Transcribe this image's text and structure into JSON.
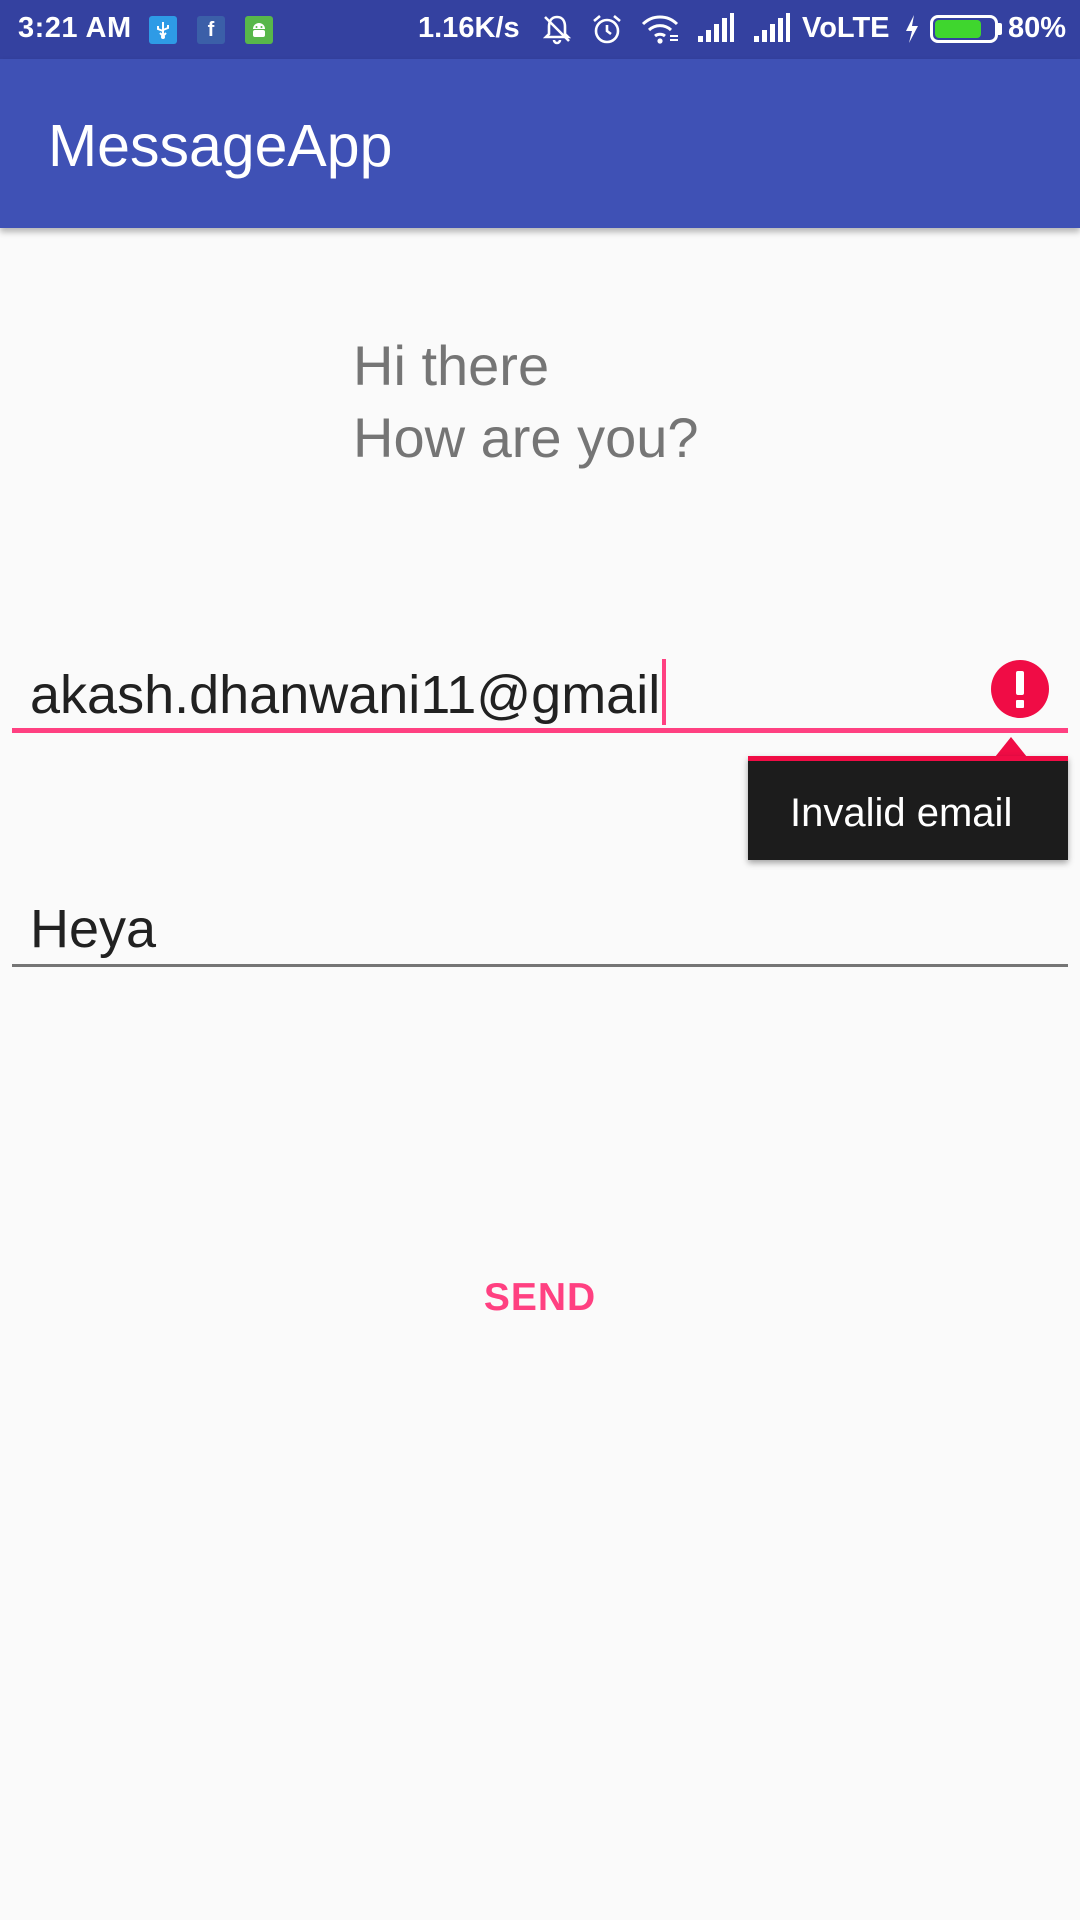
{
  "status_bar": {
    "time": "3:21 AM",
    "network_speed": "1.16K/s",
    "network_type": "VoLTE",
    "battery_percent": "80%",
    "battery_level": 0.8,
    "notification_icons": [
      "usb-icon",
      "facebook-icon",
      "android-icon"
    ],
    "status_icons": [
      "mute-icon",
      "alarm-icon",
      "wifi-icon",
      "signal-icon",
      "signal-icon",
      "charging-icon",
      "battery-icon"
    ],
    "facebook_glyph": "f"
  },
  "app_bar": {
    "title": "MessageApp"
  },
  "message": {
    "line1": "Hi there",
    "line2": "How are you?"
  },
  "email_field": {
    "value": "akash.dhanwani11@gmail",
    "error": "Invalid email"
  },
  "message_field": {
    "value": "Heya"
  },
  "send_button": {
    "label": "SEND"
  },
  "colors": {
    "status_bar": "#3441a0",
    "app_bar": "#3f51b5",
    "accent": "#ff4081",
    "error": "#f00c45",
    "background": "#fafafa"
  }
}
